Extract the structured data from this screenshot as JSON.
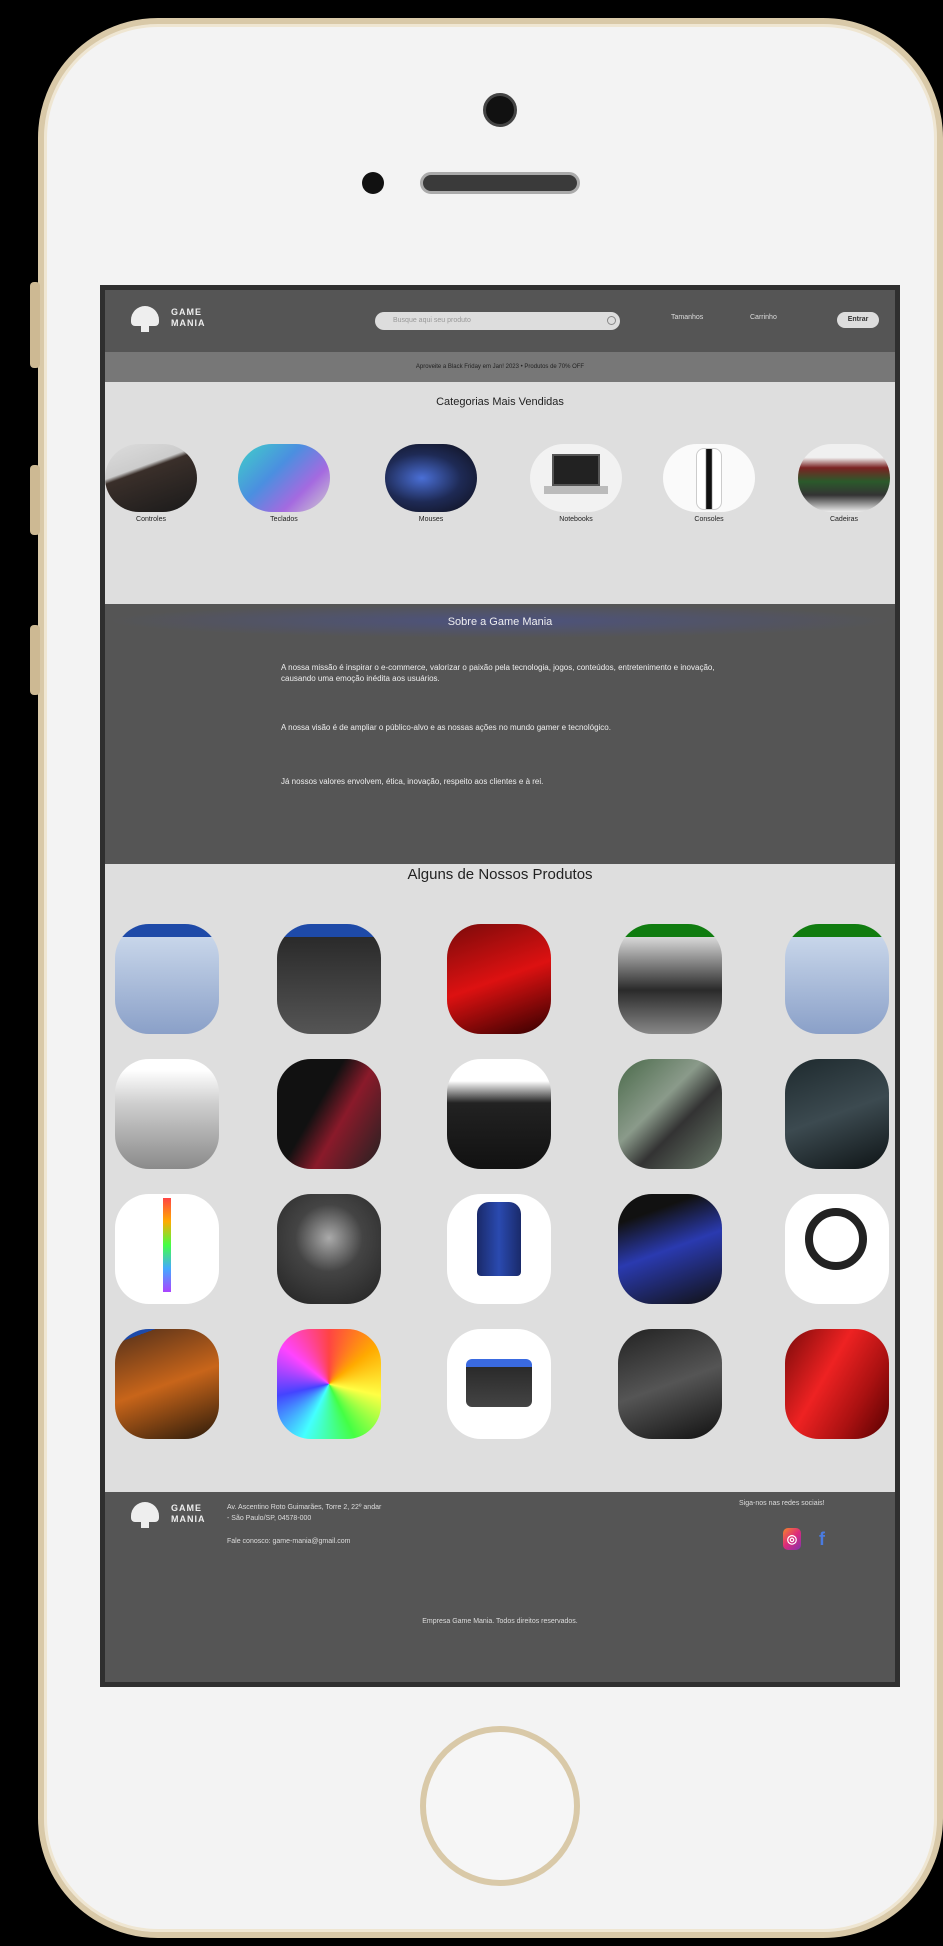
{
  "header": {
    "logo_line1": "GAME",
    "logo_line2": "MANIA",
    "search_placeholder": "Busque aqui seu produto",
    "nav_left": "Tamanhos",
    "nav_right": "Carrinho",
    "login_label": "Entrar"
  },
  "promo": {
    "text": "Aproveite a Black Friday em Jan! 2023 • Produtos de 70% OFF"
  },
  "categories": {
    "title": "Categorias Mais Vendidas",
    "items": [
      {
        "label": "Controles"
      },
      {
        "label": "Teclados"
      },
      {
        "label": "Mouses"
      },
      {
        "label": "Notebooks"
      },
      {
        "label": "Consoles"
      },
      {
        "label": "Cadeiras"
      }
    ]
  },
  "about": {
    "title": "Sobre a Game Mania",
    "p1": "A nossa missão é inspirar o e-commerce, valorizar o paixão pela tecnologia, jogos, conteúdos, entretenimento e inovação, causando uma emoção inédita aos usuários.",
    "p2": "A nossa visão é de ampliar o público-alvo e as nossas ações no mundo gamer e tecnológico.",
    "p3": "Já nossos valores envolvem, ética, inovação, respeito aos clientes e à rei."
  },
  "products": {
    "title": "Alguns de Nossos Produtos"
  },
  "footer": {
    "logo_line1": "GAME",
    "logo_line2": "MANIA",
    "address_line1": "Av. Ascentino Roto Guimarães, Torre 2, 22º andar",
    "address_line2": "- São Paulo/SP, 04578-000",
    "email": "Fale conosco: game-mania@gmail.com",
    "follow": "Siga-nos nas redes sociais!",
    "copyright": "Empresa Game Mania. Todos direitos reservados."
  },
  "colors": {
    "header_bg": "#555555",
    "section_light": "#dedede",
    "promo_bg": "#777777"
  }
}
